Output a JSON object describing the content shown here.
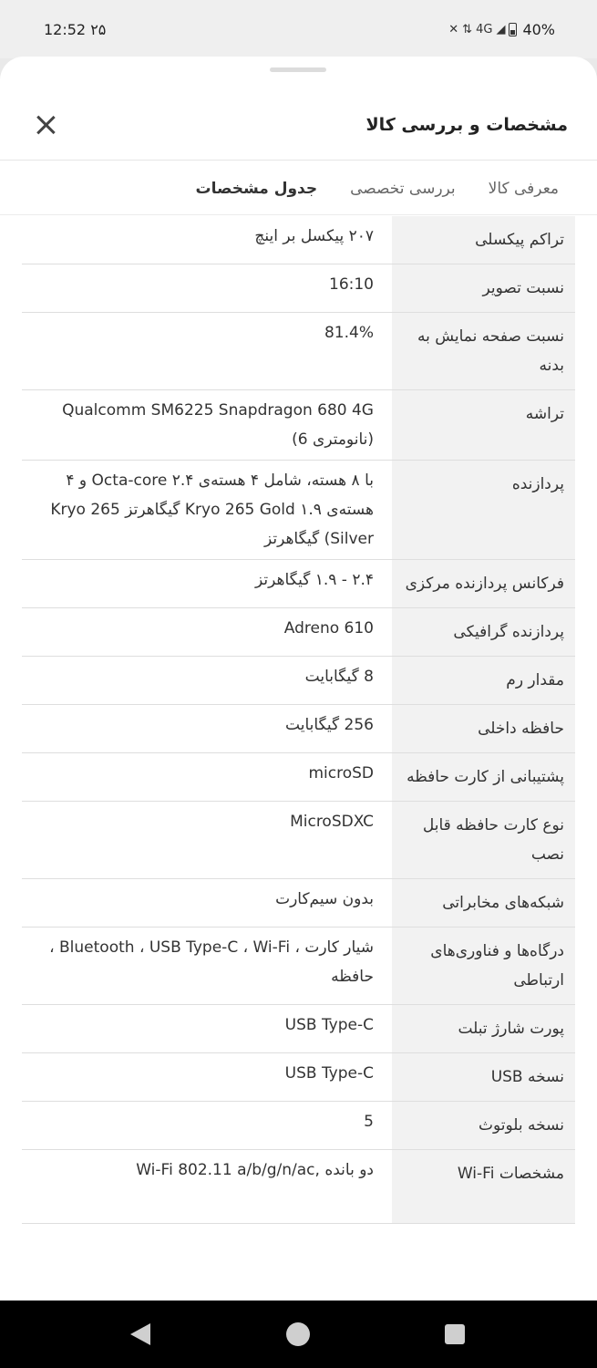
{
  "status_bar": {
    "time": "12:52",
    "date_digits": "۲۵",
    "network": "4G",
    "battery": "40%"
  },
  "sheet": {
    "title": "مشخصات و بررسی کالا"
  },
  "tabs": [
    {
      "label": "معرفی کالا",
      "active": false
    },
    {
      "label": "بررسی تخصصی",
      "active": false
    },
    {
      "label": "جدول مشخصات",
      "active": true
    }
  ],
  "specs": [
    {
      "label": "تراکم پیکسلی",
      "value": "۲۰۷  پیکسل بر اینچ"
    },
    {
      "label": "نسبت تصویر",
      "value": "16:10"
    },
    {
      "label": "نسبت صفحه نمایش به بدنه",
      "value": "81.4%"
    },
    {
      "label": "تراشه",
      "value": "Qualcomm SM6225 Snapdragon 680 4G (نانومتری 6)"
    },
    {
      "label": "پردازنده",
      "value": "با ۸ هسته، شامل ۴ هسته‌ی ۲.۴ Octa-core و ۴ هسته‌ی ۱.۹ Kryo 265 Gold گیگاهرتز Kryo 265 Silver) گیگاهرتز"
    },
    {
      "label": "فرکانس پردازنده مرکزی",
      "value": "۲.۴ - ۱.۹ گیگاهرتز"
    },
    {
      "label": "پردازنده گرافیکی",
      "value": "Adreno 610"
    },
    {
      "label": "مقدار رم",
      "value": "8 گیگابایت"
    },
    {
      "label": "حافظه داخلی",
      "value": "256 گیگابایت"
    },
    {
      "label": "پشتیبانی از کارت حافظه",
      "value": "microSD"
    },
    {
      "label": "نوع کارت حافظه قابل نصب",
      "value": "MicroSDXC"
    },
    {
      "label": "شبکه‌های مخابراتی",
      "value": "بدون سیم‌کارت"
    },
    {
      "label": "درگاه‌ها و فناوری‌های ارتباطی",
      "value": "شیار کارت ، Bluetooth ، USB Type-C ، Wi-Fi ، حافظه"
    },
    {
      "label": "پورت شارژ تبلت",
      "value": "USB Type-C"
    },
    {
      "label": "نسخه USB",
      "value": "USB Type-C"
    },
    {
      "label": "نسخه بلوتوث",
      "value": "5"
    },
    {
      "label": "مشخصات Wi-Fi",
      "value": "دو بانده ,Wi-Fi 802.11 a/b/g/n/ac"
    }
  ]
}
